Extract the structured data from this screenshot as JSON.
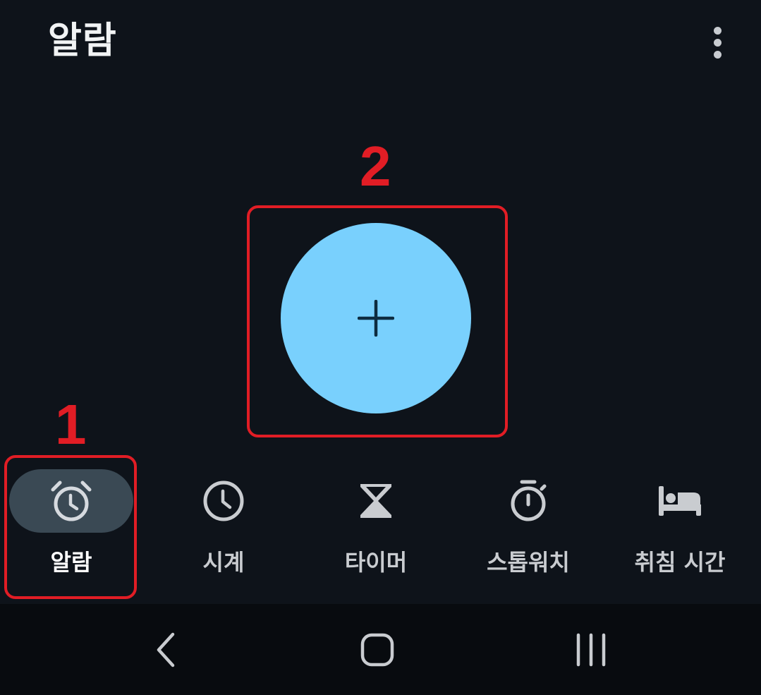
{
  "header": {
    "title": "알람"
  },
  "annotations": [
    {
      "number": "1"
    },
    {
      "number": "2"
    }
  ],
  "colors": {
    "fab": "#79d0fd",
    "annotation": "#e11d25",
    "background": "#0e131a",
    "active_tab_bg": "#3a4954"
  },
  "fab": {
    "icon": "plus-icon"
  },
  "tabs": [
    {
      "label": "알람",
      "icon": "alarm-clock-icon",
      "active": true
    },
    {
      "label": "시계",
      "icon": "clock-icon",
      "active": false
    },
    {
      "label": "타이머",
      "icon": "hourglass-icon",
      "active": false
    },
    {
      "label": "스톱워치",
      "icon": "stopwatch-icon",
      "active": false
    },
    {
      "label": "취침 시간",
      "icon": "bed-icon",
      "active": false
    }
  ],
  "system_nav": [
    {
      "icon": "back-icon"
    },
    {
      "icon": "home-icon"
    },
    {
      "icon": "recents-icon"
    }
  ]
}
